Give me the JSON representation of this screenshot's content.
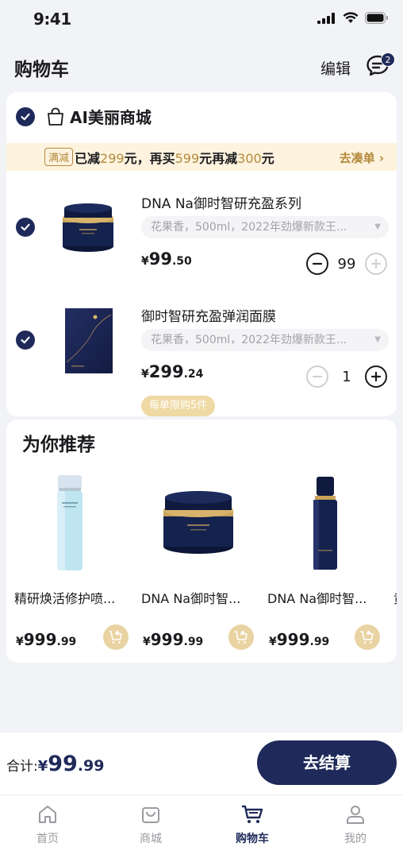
{
  "status_bar": {
    "time": "9:41"
  },
  "header": {
    "title": "购物车",
    "edit_label": "编辑",
    "message_badge": "2"
  },
  "store": {
    "name": "AI美丽商城"
  },
  "promo": {
    "tag": "满减",
    "text_prefix": "已减",
    "amount1": "299",
    "text_mid1": "元，再买",
    "amount2": "599",
    "text_mid2": "元再减",
    "amount3": "300",
    "text_suffix": "元",
    "link_label": "去凑单 ›"
  },
  "cart_items": [
    {
      "title": "DNA Na御时智研充盈系列",
      "spec": "花果香，500ml，2022年劲爆新款王...",
      "price_currency": "¥",
      "price_int": "99",
      "price_dec": ".50",
      "quantity": "99",
      "limit_tag": ""
    },
    {
      "title": "御时智研充盈弹润面膜",
      "spec": "花果香，500ml，2022年劲爆新款王...",
      "price_currency": "¥",
      "price_int": "299",
      "price_dec": ".24",
      "quantity": "1",
      "limit_tag": "每单限购5件"
    }
  ],
  "recommend": {
    "title": "为你推荐",
    "items": [
      {
        "name": "精研焕活修护喷...",
        "price_currency": "¥",
        "price_int": "999",
        "price_dec": ".99"
      },
      {
        "name": "DNA Na御时智...",
        "price_currency": "¥",
        "price_int": "999",
        "price_dec": ".99"
      },
      {
        "name": "DNA Na御时智...",
        "price_currency": "¥",
        "price_int": "999",
        "price_dec": ".99"
      },
      {
        "name": "黄",
        "price_currency": "",
        "price_int": "",
        "price_dec": ""
      }
    ]
  },
  "checkout": {
    "total_label": "合计:",
    "currency": "¥",
    "amount_int": "99",
    "amount_dec": ".99",
    "button_label": "去结算"
  },
  "tabs": [
    {
      "label": "首页",
      "icon": "home-icon",
      "active": false
    },
    {
      "label": "商城",
      "icon": "shop-bag-icon",
      "active": false
    },
    {
      "label": "购物车",
      "icon": "cart-icon",
      "active": true
    },
    {
      "label": "我的",
      "icon": "user-icon",
      "active": false
    }
  ],
  "colors": {
    "primary": "#1f2a5a",
    "gold": "#b58a3d",
    "promo_bg": "#fdf3de"
  }
}
